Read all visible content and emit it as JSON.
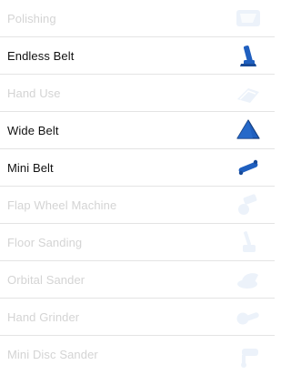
{
  "menu": {
    "items": [
      {
        "label": "Polishing",
        "state": "disabled",
        "icon": "polishing-icon"
      },
      {
        "label": "Endless Belt",
        "state": "enabled",
        "icon": "endless-belt-icon"
      },
      {
        "label": "Hand Use",
        "state": "disabled",
        "icon": "hand-use-icon"
      },
      {
        "label": "Wide Belt",
        "state": "enabled",
        "icon": "wide-belt-icon"
      },
      {
        "label": "Mini Belt",
        "state": "enabled",
        "icon": "mini-belt-icon"
      },
      {
        "label": "Flap Wheel Machine",
        "state": "disabled",
        "icon": "flap-wheel-icon"
      },
      {
        "label": "Floor Sanding",
        "state": "disabled",
        "icon": "floor-sanding-icon"
      },
      {
        "label": "Orbital Sander",
        "state": "disabled",
        "icon": "orbital-sander-icon"
      },
      {
        "label": "Hand Grinder",
        "state": "disabled",
        "icon": "hand-grinder-icon"
      },
      {
        "label": "Mini Disc Sander",
        "state": "disabled",
        "icon": "mini-disc-sander-icon"
      }
    ]
  },
  "colors": {
    "active_text": "#111111",
    "inactive_text": "#d4d4d4",
    "icon_blue": "#1f5fbf",
    "icon_light_blue": "#bcd3ee",
    "divider": "#e4e4e4"
  }
}
